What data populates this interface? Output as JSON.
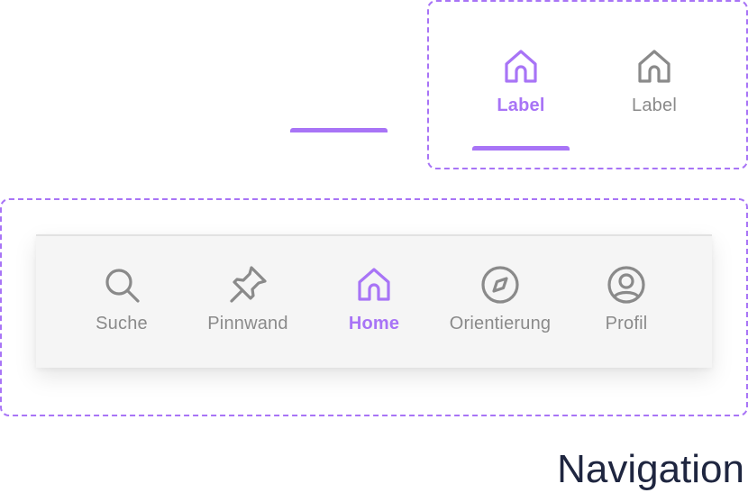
{
  "variants": {
    "active_label": "Label",
    "active_icon": "home-icon",
    "inactive_label": "Label",
    "inactive_icon": "home-icon"
  },
  "navigation": {
    "items": [
      {
        "label": "Suche",
        "icon": "search-icon",
        "active": false
      },
      {
        "label": "Pinnwand",
        "icon": "pin-icon",
        "active": false
      },
      {
        "label": "Home",
        "icon": "home-icon",
        "active": true
      },
      {
        "label": "Orientierung",
        "icon": "compass-icon",
        "active": false
      },
      {
        "label": "Profil",
        "icon": "profile-icon",
        "active": false
      }
    ]
  },
  "caption": "Navigation",
  "colors": {
    "accent": "#a874f6",
    "inactive": "#8a8a8a",
    "bar_background": "#f5f5f5",
    "caption": "#1f2640"
  }
}
